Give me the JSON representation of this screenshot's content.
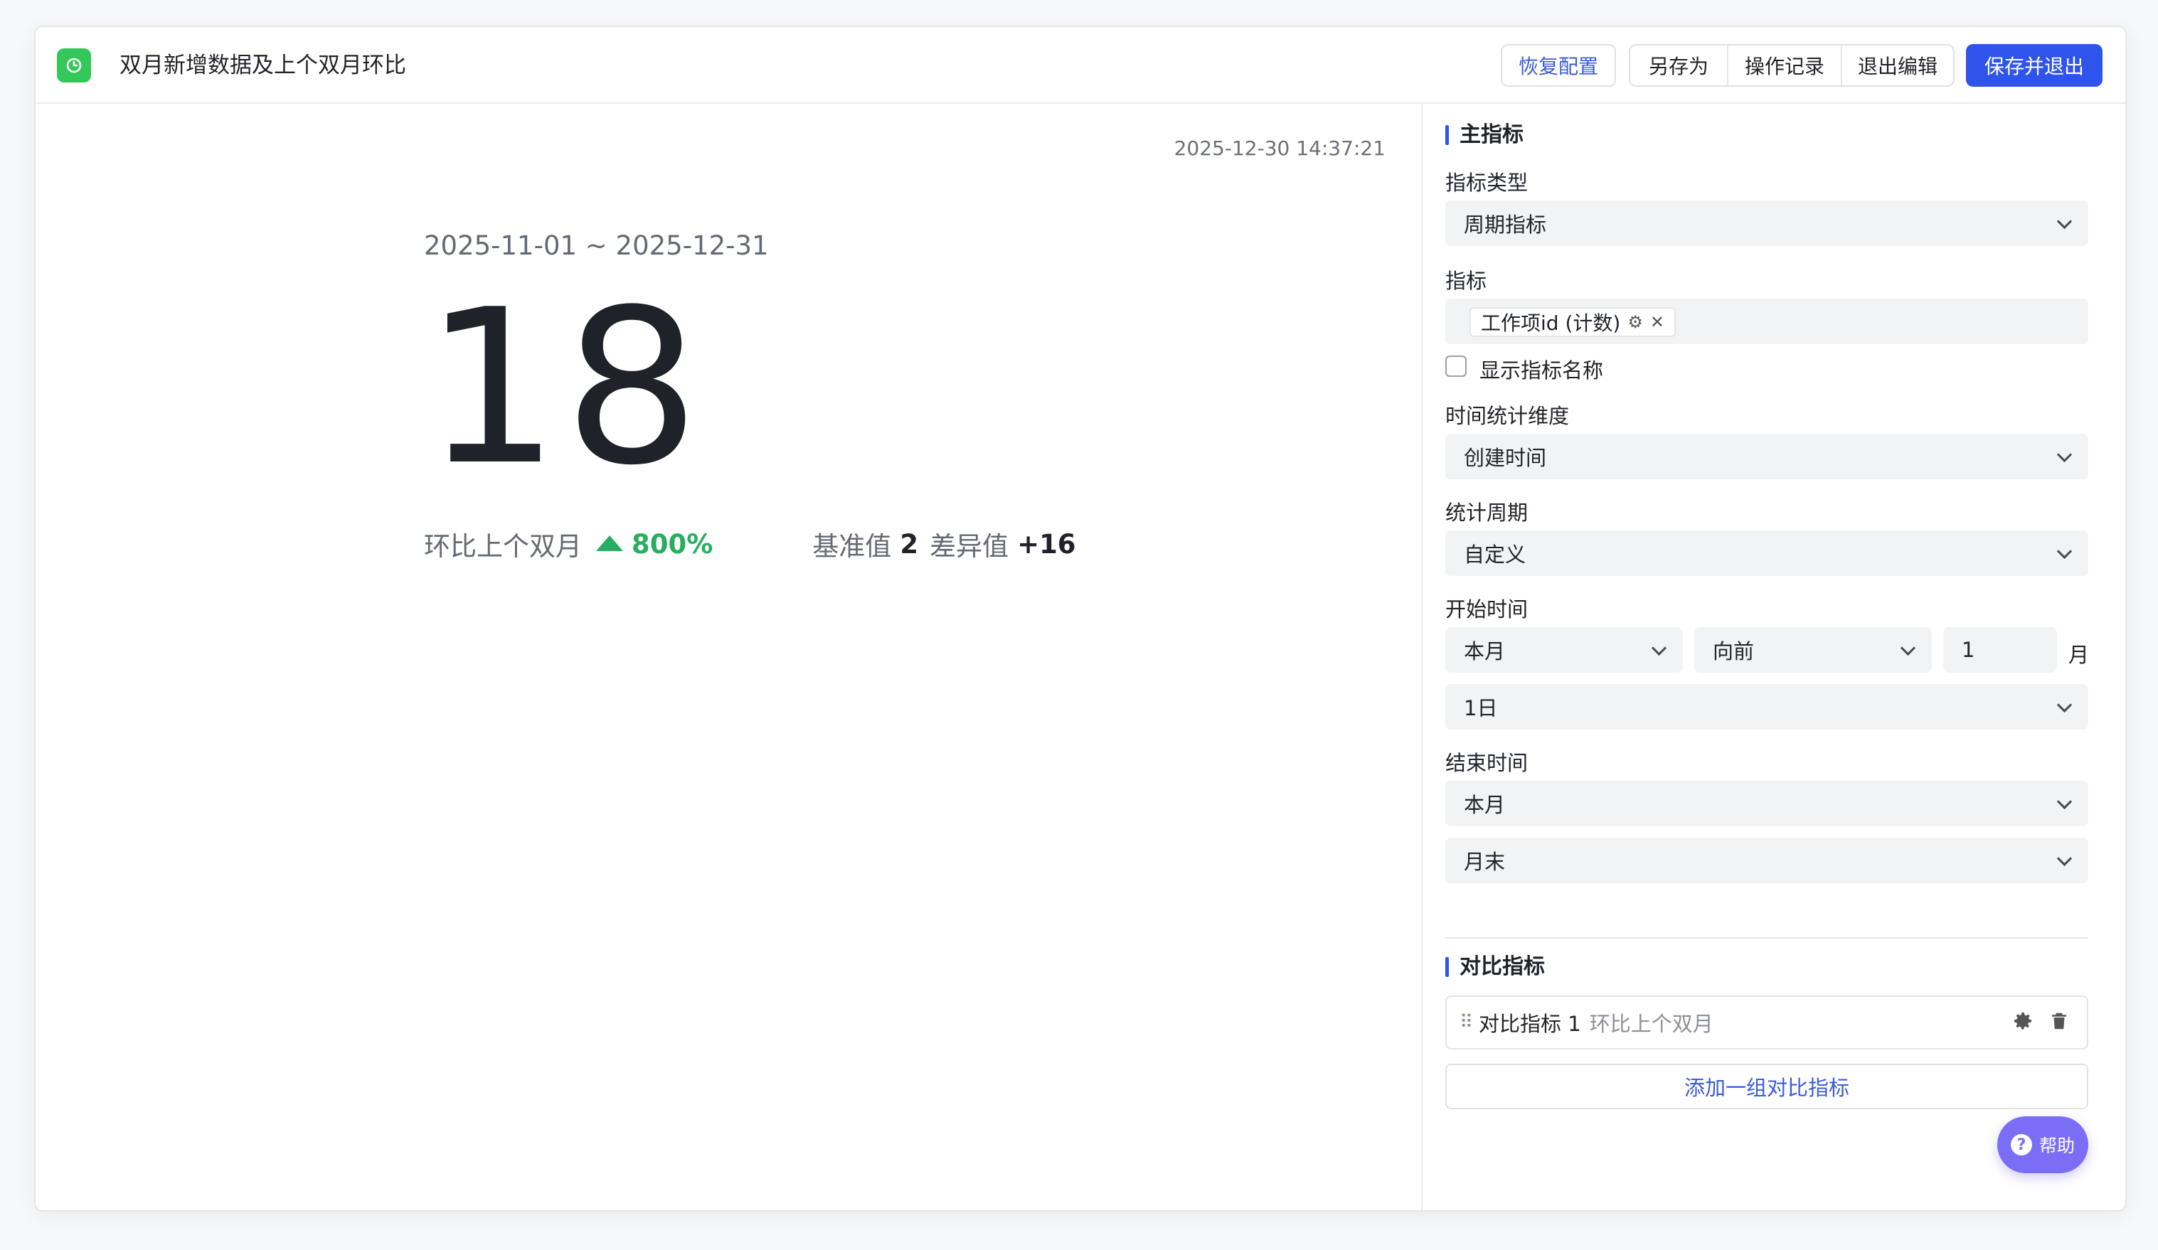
{
  "header": {
    "title": "双月新增数据及上个双月环比",
    "restore_label": "恢复配置",
    "save_as_label": "另存为",
    "log_label": "操作记录",
    "exit_label": "退出编辑",
    "save_exit_label": "保存并退出"
  },
  "preview": {
    "timestamp": "2025-12-30 14:37:21",
    "date_range": "2025-11-01 ~ 2025-12-31",
    "value": "18",
    "compare_label": "环比上个双月",
    "compare_percent": "800%",
    "base_label": "基准值",
    "base_value": "2",
    "diff_label": "差异值",
    "diff_value": "+16"
  },
  "panel": {
    "main_title": "主指标",
    "metric_type_label": "指标类型",
    "metric_type_value": "周期指标",
    "metric_label": "指标",
    "metric_tag": "工作项id (计数)",
    "show_name_label": "显示指标名称",
    "time_dim_label": "时间统计维度",
    "time_dim_value": "创建时间",
    "period_label": "统计周期",
    "period_value": "自定义",
    "start_label": "开始时间",
    "start_month": "本月",
    "start_direction": "向前",
    "start_offset": "1",
    "start_unit": "月",
    "start_day": "1日",
    "end_label": "结束时间",
    "end_month": "本月",
    "end_day": "月末",
    "compare_title": "对比指标",
    "compare_item_name": "对比指标 1",
    "compare_item_desc": "环比上个双月",
    "add_compare_label": "添加一组对比指标"
  },
  "help_label": "帮助",
  "colors": {
    "primary": "#2f54eb",
    "up_green": "#27ae60",
    "logo_green": "#34c759",
    "help_purple": "#7b6ef6"
  }
}
